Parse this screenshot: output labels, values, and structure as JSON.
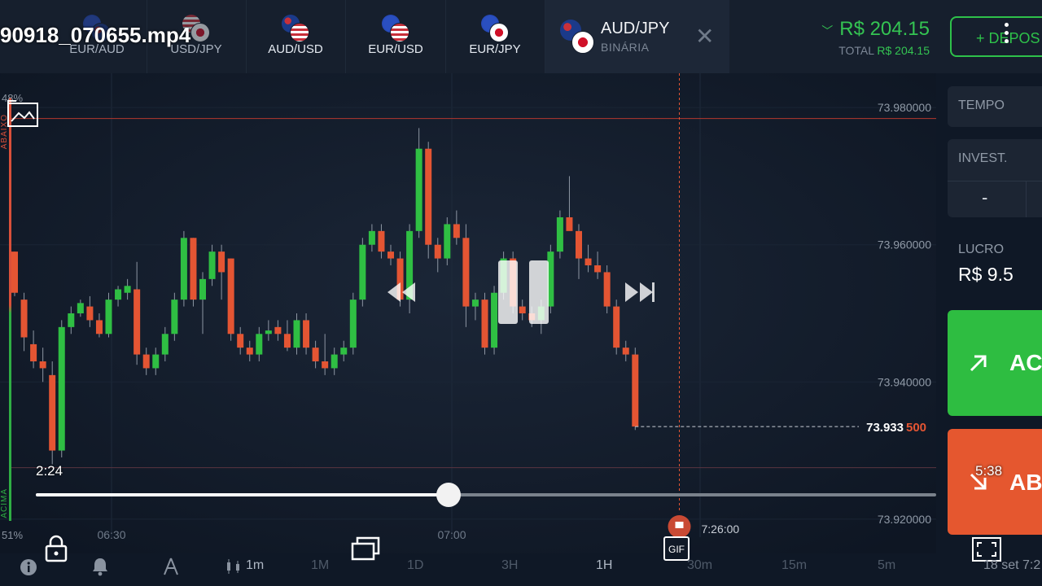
{
  "video": {
    "filename": "90918_070655.mp4",
    "elapsed": "2:24",
    "remaining": "5:38",
    "progress": 0.458
  },
  "tabs": [
    {
      "pair": "EUR/AUD",
      "flags": [
        "eu",
        "au"
      ],
      "dim": true
    },
    {
      "pair": "USD/JPY",
      "flags": [
        "us",
        "jp"
      ],
      "dim": true
    },
    {
      "pair": "AUD/USD",
      "flags": [
        "au",
        "us"
      ],
      "dim": false
    },
    {
      "pair": "EUR/USD",
      "flags": [
        "eu",
        "us"
      ],
      "dim": false
    },
    {
      "pair": "EUR/JPY",
      "flags": [
        "eu",
        "jp"
      ],
      "dim": false
    }
  ],
  "active_asset": {
    "name": "AUD/JPY",
    "type": "BINÁRIA"
  },
  "balance": {
    "amount": "R$ 204.15",
    "total_label": "TOTAL",
    "total_value": "R$ 204.15"
  },
  "deposit_label": "+ DEPOS",
  "panel": {
    "time_label": "TEMPO",
    "invest_label": "INVEST.",
    "minus": "-",
    "profit_label": "LUCRO",
    "profit_value": "R$ 9.5",
    "buy_label": "AC",
    "sell_label": "AB"
  },
  "side": {
    "top_pct": "48%",
    "bottom_pct": "51%",
    "top_label": "ABAIXO",
    "bottom_label": "ACIMA"
  },
  "chart_data": {
    "type": "candlestick",
    "y_ticks": [
      "73.980000",
      "73.960000",
      "73.940000",
      "73.933 500",
      "73.920000"
    ],
    "current_price_main": "73.933",
    "current_price_tail": "500",
    "x_ticks": [
      "06:30",
      "07:00",
      "7:26:00"
    ],
    "ylim": [
      73.915,
      73.985
    ],
    "upper_level": 73.9784,
    "lower_level": 73.9275,
    "current_price": 73.9335,
    "expiry_index": 70,
    "candles": [
      [
        73.959,
        73.959,
        73.9525,
        73.953
      ],
      [
        73.952,
        73.953,
        73.9445,
        73.9465
      ],
      [
        73.9455,
        73.9475,
        73.942,
        73.943
      ],
      [
        73.943,
        73.945,
        73.94,
        73.942
      ],
      [
        73.941,
        73.943,
        73.928,
        73.93
      ],
      [
        73.93,
        73.949,
        73.929,
        73.948
      ],
      [
        73.948,
        73.951,
        73.947,
        73.95
      ],
      [
        73.95,
        73.952,
        73.9495,
        73.9515
      ],
      [
        73.951,
        73.9525,
        73.948,
        73.949
      ],
      [
        73.949,
        73.95,
        73.9465,
        73.947
      ],
      [
        73.947,
        73.953,
        73.9465,
        73.952
      ],
      [
        73.952,
        73.954,
        73.951,
        73.9535
      ],
      [
        73.953,
        73.955,
        73.952,
        73.954
      ],
      [
        73.9535,
        73.9575,
        73.9425,
        73.944
      ],
      [
        73.944,
        73.945,
        73.941,
        73.942
      ],
      [
        73.942,
        73.945,
        73.941,
        73.944
      ],
      [
        73.944,
        73.948,
        73.943,
        73.947
      ],
      [
        73.947,
        73.953,
        73.946,
        73.952
      ],
      [
        73.952,
        73.962,
        73.951,
        73.961
      ],
      [
        73.961,
        73.961,
        73.951,
        73.952
      ],
      [
        73.952,
        73.956,
        73.947,
        73.955
      ],
      [
        73.955,
        73.96,
        73.954,
        73.959
      ],
      [
        73.959,
        73.96,
        73.952,
        73.956
      ],
      [
        73.958,
        73.958,
        73.946,
        73.947
      ],
      [
        73.947,
        73.948,
        73.944,
        73.945
      ],
      [
        73.945,
        73.946,
        73.943,
        73.944
      ],
      [
        73.944,
        73.948,
        73.943,
        73.947
      ],
      [
        73.947,
        73.949,
        73.946,
        73.9475
      ],
      [
        73.948,
        73.949,
        73.946,
        73.947
      ],
      [
        73.947,
        73.949,
        73.9445,
        73.945
      ],
      [
        73.945,
        73.95,
        73.944,
        73.949
      ],
      [
        73.949,
        73.95,
        73.944,
        73.945
      ],
      [
        73.945,
        73.946,
        73.942,
        73.943
      ],
      [
        73.943,
        73.947,
        73.941,
        73.942
      ],
      [
        73.942,
        73.945,
        73.941,
        73.944
      ],
      [
        73.944,
        73.946,
        73.943,
        73.945
      ],
      [
        73.945,
        73.953,
        73.944,
        73.952
      ],
      [
        73.952,
        73.961,
        73.951,
        73.96
      ],
      [
        73.96,
        73.963,
        73.959,
        73.962
      ],
      [
        73.962,
        73.963,
        73.958,
        73.959
      ],
      [
        73.959,
        73.96,
        73.957,
        73.958
      ],
      [
        73.958,
        73.959,
        73.951,
        73.952
      ],
      [
        73.952,
        73.963,
        73.95,
        73.962
      ],
      [
        73.962,
        73.977,
        73.961,
        73.974
      ],
      [
        73.974,
        73.975,
        73.958,
        73.96
      ],
      [
        73.96,
        73.961,
        73.956,
        73.958
      ],
      [
        73.958,
        73.964,
        73.957,
        73.963
      ],
      [
        73.963,
        73.965,
        73.96,
        73.961
      ],
      [
        73.961,
        73.963,
        73.948,
        73.951
      ],
      [
        73.951,
        73.953,
        73.949,
        73.952
      ],
      [
        73.952,
        73.953,
        73.944,
        73.945
      ],
      [
        73.945,
        73.954,
        73.944,
        73.953
      ],
      [
        73.953,
        73.959,
        73.952,
        73.958
      ],
      [
        73.958,
        73.959,
        73.95,
        73.951
      ],
      [
        73.951,
        73.952,
        73.949,
        73.95
      ],
      [
        73.95,
        73.951,
        73.948,
        73.949
      ],
      [
        73.949,
        73.952,
        73.947,
        73.951
      ],
      [
        73.951,
        73.96,
        73.95,
        73.959
      ],
      [
        73.959,
        73.965,
        73.958,
        73.964
      ],
      [
        73.964,
        73.97,
        73.963,
        73.962
      ],
      [
        73.962,
        73.963,
        73.955,
        73.958
      ],
      [
        73.958,
        73.96,
        73.956,
        73.957
      ],
      [
        73.957,
        73.959,
        73.955,
        73.956
      ],
      [
        73.956,
        73.957,
        73.95,
        73.951
      ],
      [
        73.951,
        73.952,
        73.944,
        73.945
      ],
      [
        73.945,
        73.946,
        73.943,
        73.944
      ],
      [
        73.944,
        73.945,
        73.933,
        73.9335
      ]
    ]
  }
}
